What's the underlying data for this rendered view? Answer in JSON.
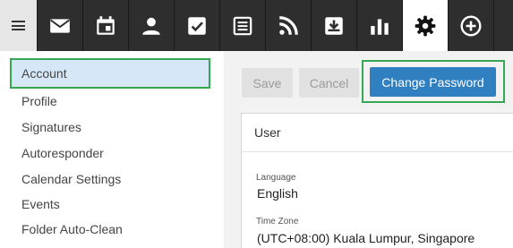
{
  "toolbar": {
    "items": [
      {
        "icon": "mail-icon"
      },
      {
        "icon": "calendar-icon"
      },
      {
        "icon": "contacts-icon"
      },
      {
        "icon": "tasks-icon"
      },
      {
        "icon": "notes-icon"
      },
      {
        "icon": "rss-icon"
      },
      {
        "icon": "archive-icon"
      },
      {
        "icon": "reports-icon"
      },
      {
        "icon": "settings-icon",
        "active": true
      },
      {
        "icon": "add-icon"
      }
    ]
  },
  "sidebar": {
    "items": [
      {
        "label": "Account",
        "selected": true
      },
      {
        "label": "Profile"
      },
      {
        "label": "Signatures"
      },
      {
        "label": "Autoresponder"
      },
      {
        "label": "Calendar Settings"
      },
      {
        "label": "Events"
      },
      {
        "label": "Folder Auto-Clean"
      }
    ]
  },
  "actions": {
    "save_label": "Save",
    "cancel_label": "Cancel",
    "change_password_label": "Change Password"
  },
  "user_card": {
    "title": "User",
    "language_label": "Language",
    "language_value": "English",
    "timezone_label": "Time Zone",
    "timezone_value": "(UTC+08:00) Kuala Lumpur, Singapore"
  },
  "colors": {
    "toolbar_bg": "#2e2e2e",
    "selected_bg": "#d6e8f7",
    "highlight_border": "#34a853",
    "primary_button": "#2f7fc1"
  }
}
